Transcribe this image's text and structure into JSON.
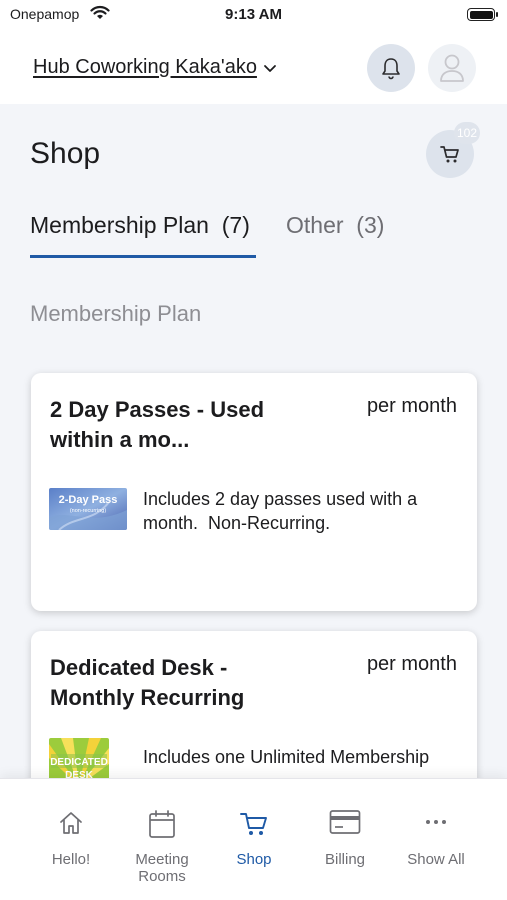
{
  "status_bar": {
    "carrier": "Onepamop",
    "time": "9:13 AM"
  },
  "header": {
    "location": "Hub Coworking Kaka'ako"
  },
  "page": {
    "title": "Shop",
    "cart_count": "102"
  },
  "tabs": [
    {
      "label": "Membership Plan  (7)",
      "active": true
    },
    {
      "label": "Other  (3)",
      "active": false
    }
  ],
  "section_title": "Membership Plan",
  "cards": [
    {
      "title": "2 Day Passes - Used within a mo...",
      "price": "per month",
      "thumb_text": "2-Day Pass",
      "thumb_subtext": "(non-recurring)",
      "description": "Includes 2 day passes used with a month.  Non-Recurring."
    },
    {
      "title": "Dedicated Desk - Monthly Recurring",
      "price": "per month",
      "thumb_text": "DEDICATED",
      "thumb_subtext": "DESK",
      "description": "Includes one Unlimited Membership"
    }
  ],
  "bottom_nav": [
    {
      "label": "Hello!",
      "icon": "home-icon"
    },
    {
      "label": "Meeting Rooms",
      "icon": "calendar-icon"
    },
    {
      "label": "Shop",
      "icon": "cart-icon",
      "active": true
    },
    {
      "label": "Billing",
      "icon": "credit-card-icon"
    },
    {
      "label": "Show All",
      "icon": "more-icon"
    }
  ],
  "colors": {
    "accent": "#1f5aa6",
    "background": "#f3f5f9",
    "icon_circle": "#dde3ec"
  }
}
